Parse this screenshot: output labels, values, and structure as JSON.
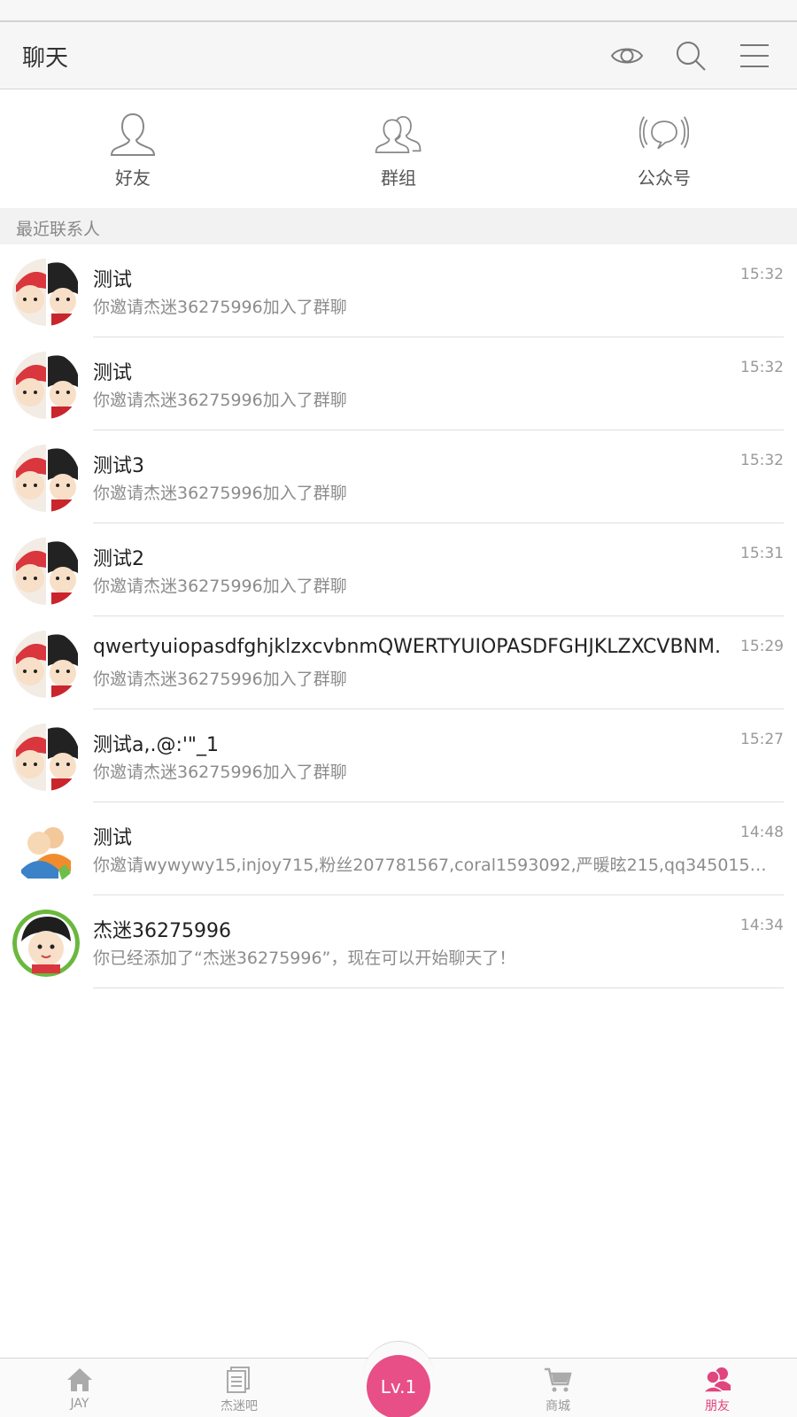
{
  "header": {
    "title": "聊天",
    "icons": [
      "eye-icon",
      "search-icon",
      "menu-icon"
    ]
  },
  "categories": [
    {
      "label": "好友",
      "icon": "person-icon"
    },
    {
      "label": "群组",
      "icon": "group-icon"
    },
    {
      "label": "公众号",
      "icon": "broadcast-icon"
    }
  ],
  "section": {
    "title": "最近联系人"
  },
  "contacts": [
    {
      "name": "测试",
      "preview": "你邀请杰迷36275996加入了群聊",
      "time": "15:32",
      "avatar": "group-avatar"
    },
    {
      "name": "测试",
      "preview": "你邀请杰迷36275996加入了群聊",
      "time": "15:32",
      "avatar": "group-avatar"
    },
    {
      "name": "测试3",
      "preview": "你邀请杰迷36275996加入了群聊",
      "time": "15:32",
      "avatar": "group-avatar"
    },
    {
      "name": "测试2",
      "preview": "你邀请杰迷36275996加入了群聊",
      "time": "15:31",
      "avatar": "group-avatar"
    },
    {
      "name": "qwertyuiopasdfghjklzxcvbnmQWERTYUIOPASDFGHJKLZXCVBNM.",
      "preview": "你邀请杰迷36275996加入了群聊",
      "time": "15:29",
      "avatar": "group-avatar"
    },
    {
      "name": "测试a,.@:'\"_1",
      "preview": "你邀请杰迷36275996加入了群聊",
      "time": "15:27",
      "avatar": "group-avatar"
    },
    {
      "name": "测试",
      "preview": "你邀请wywywy15,injoy715,粉丝207781567,coral1593092,严暖昡215,qq3450159…",
      "time": "14:48",
      "avatar": "default-group-avatar"
    },
    {
      "name": "杰迷36275996",
      "preview": "你已经添加了“杰迷36275996”，现在可以开始聊天了！",
      "time": "14:34",
      "avatar": "user-avatar"
    }
  ],
  "tabbar": {
    "tabs": [
      {
        "label": "JAY",
        "icon": "home-icon"
      },
      {
        "label": "杰迷吧",
        "icon": "forum-icon"
      },
      {
        "label": "商城",
        "icon": "cart-icon"
      },
      {
        "label": "朋友",
        "icon": "friends-icon",
        "active": true
      }
    ],
    "level": "Lv.1"
  },
  "colors": {
    "accent": "#e74f86",
    "text": "#222222",
    "muted": "#8c8c8c"
  }
}
